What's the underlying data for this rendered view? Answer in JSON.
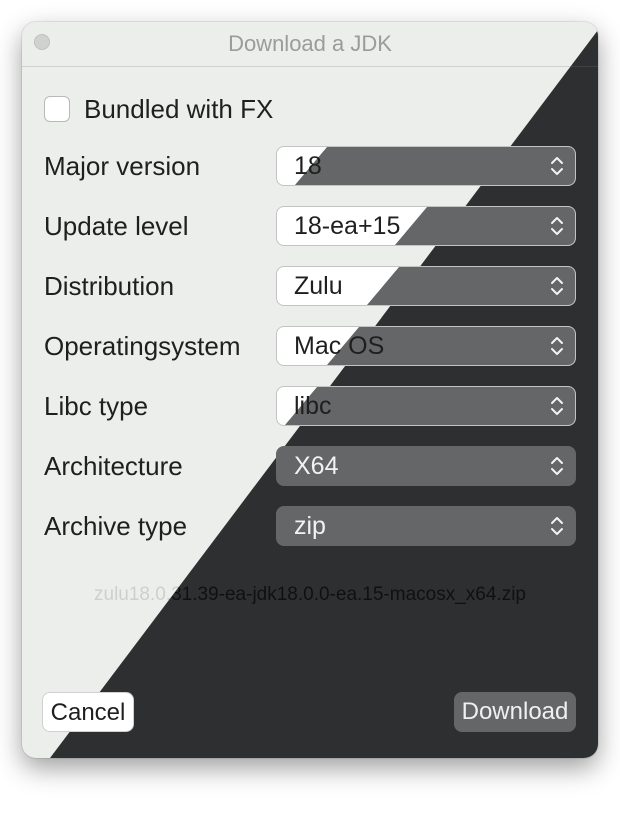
{
  "window": {
    "title": "Download a JDK"
  },
  "bundled_fx": {
    "label": "Bundled with FX",
    "checked": false
  },
  "fields": [
    {
      "label": "Major version",
      "value": "18"
    },
    {
      "label": "Update level",
      "value": "18-ea+15"
    },
    {
      "label": "Distribution",
      "value": "Zulu"
    },
    {
      "label": "Operatingsystem",
      "value": "Mac OS"
    },
    {
      "label": "Libc type",
      "value": "libc"
    },
    {
      "label": "Architecture",
      "value": "X64"
    },
    {
      "label": "Archive type",
      "value": "zip"
    }
  ],
  "filename": "zulu18.0.31.39-ea-jdk18.0.0-ea.15-macosx_x64.zip",
  "buttons": {
    "cancel": "Cancel",
    "download": "Download"
  },
  "colors": {
    "light_bg": "#eceeec",
    "dark_bg": "#2e2f30",
    "dark_control": "#656668"
  },
  "icons": {
    "select_arrows": "up-down-chevron-icon",
    "traffic_light": "window-close-dot"
  }
}
